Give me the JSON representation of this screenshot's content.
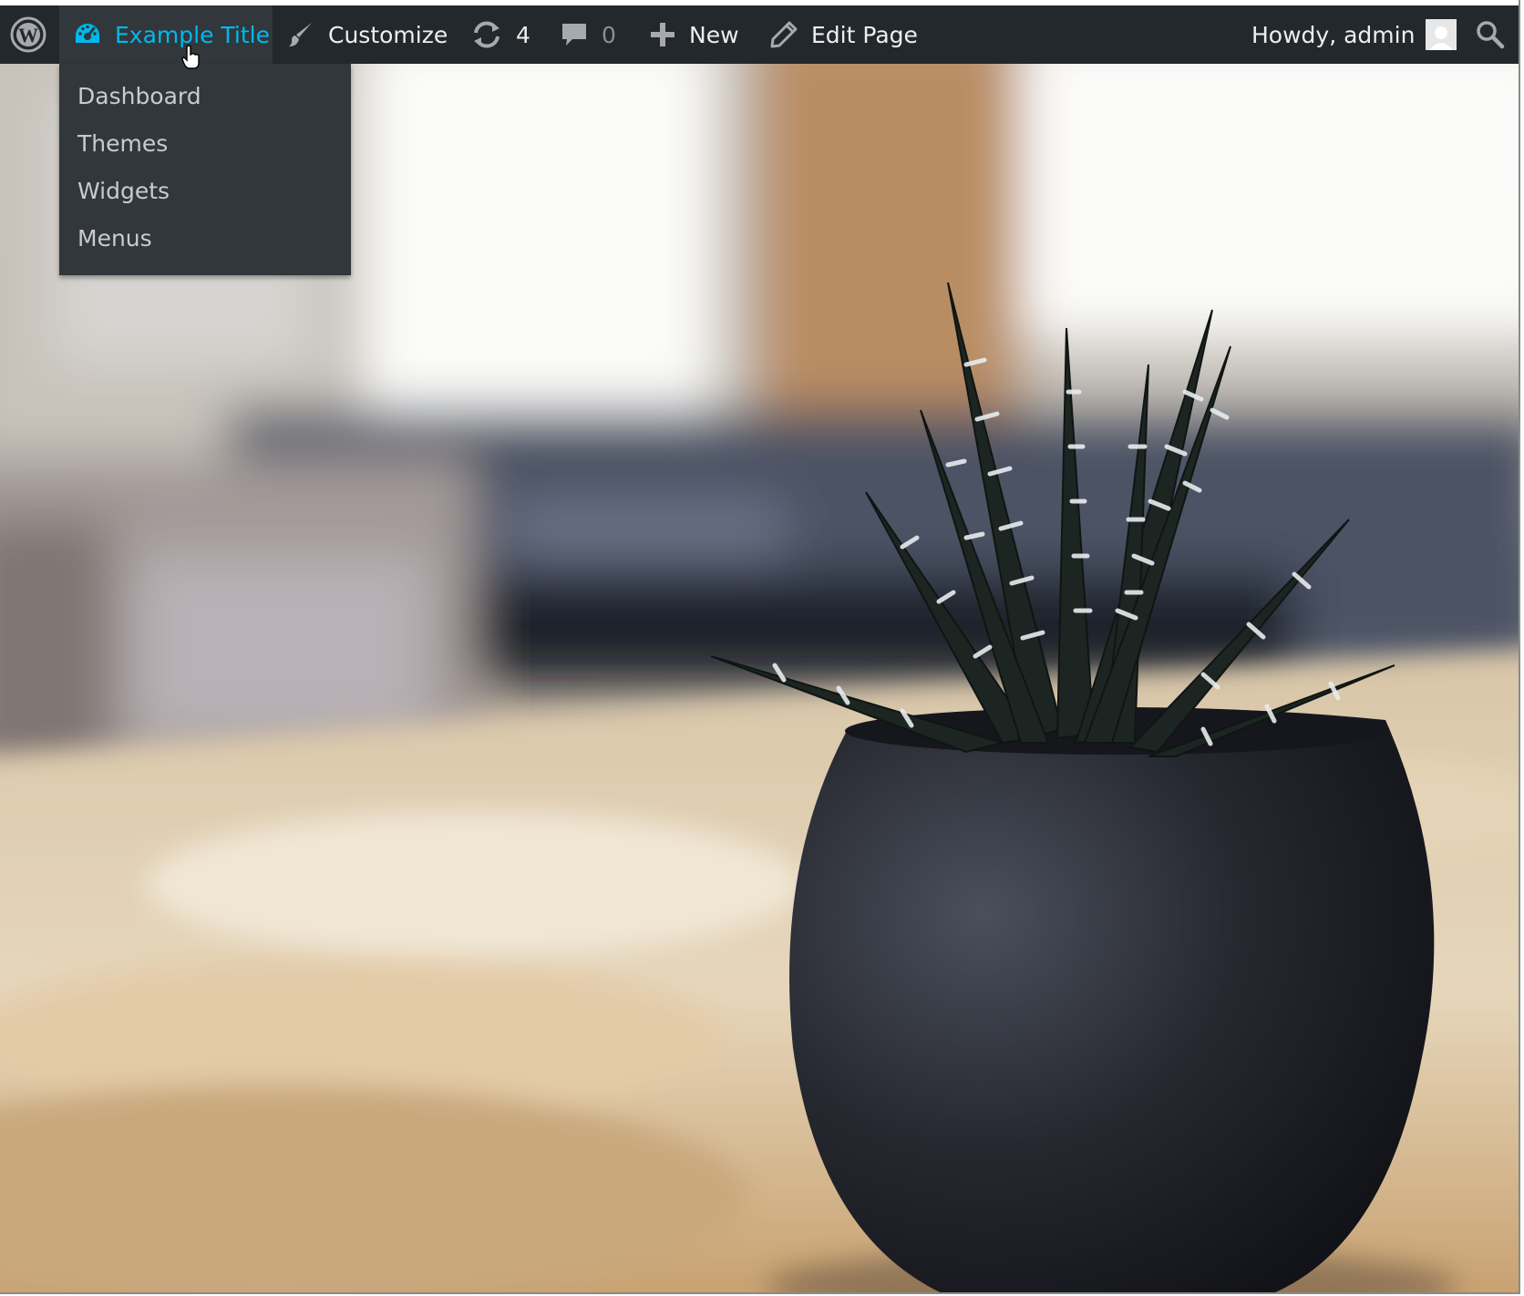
{
  "adminbar": {
    "logo_icon": "wordpress-logo-icon",
    "site_name": {
      "label": "Example Title",
      "icon": "dashboard-gauge-icon",
      "color": "#00b9eb"
    },
    "customize": {
      "label": "Customize",
      "icon": "paintbrush-icon"
    },
    "updates": {
      "count": "4",
      "icon": "refresh-icon"
    },
    "comments": {
      "count": "0",
      "icon": "comment-bubble-icon"
    },
    "new_content": {
      "label": "New",
      "icon": "plus-icon"
    },
    "edit_page": {
      "label": "Edit Page",
      "icon": "pencil-icon"
    },
    "account": {
      "greeting": "Howdy, admin",
      "icon": "avatar-icon"
    },
    "search": {
      "icon": "search-icon"
    },
    "background": "#23282d",
    "active_background": "#32373c"
  },
  "submenu": {
    "items": [
      {
        "label": "Dashboard"
      },
      {
        "label": "Themes"
      },
      {
        "label": "Widgets"
      },
      {
        "label": "Menus"
      }
    ]
  },
  "hero": {
    "image_subject": "potted zebra succulent plant on wooden table"
  }
}
